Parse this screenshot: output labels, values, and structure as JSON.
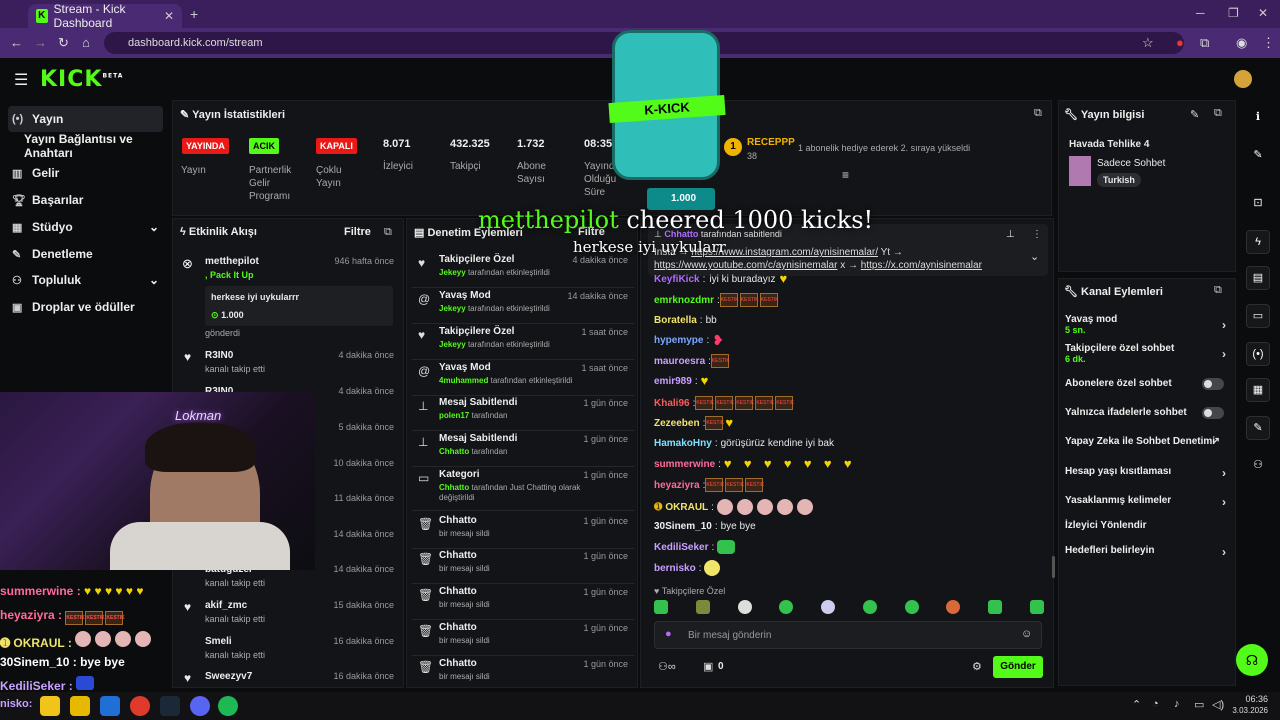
{
  "browser": {
    "tab_title": "Stream - Kick Dashboard",
    "url": "dashboard.kick.com/stream"
  },
  "logo": "KICK",
  "logo_tag": "BETA",
  "sidebar": {
    "items": [
      {
        "label": "Yayın",
        "icon": "broadcast-icon"
      },
      {
        "label": "Yayın Bağlantısı ve Anahtarı",
        "icon": ""
      },
      {
        "label": "Gelir",
        "icon": "chart-icon"
      },
      {
        "label": "Başarılar",
        "icon": "trophy-icon"
      },
      {
        "label": "Stüdyo",
        "icon": "studio-icon"
      },
      {
        "label": "Denetleme",
        "icon": "wrench-icon"
      },
      {
        "label": "Topluluk",
        "icon": "community-icon"
      },
      {
        "label": "Droplar ve ödüller",
        "icon": "gift-icon"
      }
    ]
  },
  "stats": {
    "title": "Yayın İstatistikleri",
    "status_badge": "YAYINDA",
    "status_label": "Yayın",
    "partner_badge": "ACIK",
    "partner_label": "Partnerlik Gelir Programı",
    "multi_badge": "KAPALI",
    "multi_label": "Çoklu Yayın",
    "viewers": "8.071",
    "viewers_label": "İzleyici",
    "followers": "432.325",
    "followers_label": "Takipçi",
    "subs": "1.732",
    "subs_label": "Abone Sayısı",
    "uptime": "08:35",
    "uptime_label": "Yayında Olduğu Süre"
  },
  "hype": {
    "rank": "1",
    "user": "RECEPPP",
    "count": "38",
    "message": "1 abonelik hediye ederek 2. sıraya yükseldi"
  },
  "cheer": {
    "amount": "1.000",
    "overlay_user": "metthepilot",
    "overlay_text": "cheered 1000 kicks!",
    "overlay_msg": "herkese iyi uykularr"
  },
  "activity": {
    "title": "Etkinlik Akışı",
    "filter": "Filtre",
    "items": [
      {
        "name": "metthepilot",
        "time": "946 hafta önce",
        "sub": "Pack It Up",
        "msg": "herkese iyi uykularrr",
        "amount": "1.000",
        "extra": "gönderdi"
      },
      {
        "name": "R3IN0",
        "time": "4 dakika önce",
        "sub": "kanalı takip etti"
      },
      {
        "name": "R3IN0",
        "time": "4 dakika önce",
        "sub": ""
      },
      {
        "name": "",
        "time": "5 dakika önce",
        "sub": ""
      },
      {
        "name": "",
        "time": "10 dakika önce",
        "sub": ""
      },
      {
        "name": "",
        "time": "11 dakika önce",
        "sub": ""
      },
      {
        "name": "",
        "time": "14 dakika önce",
        "sub": ""
      },
      {
        "name": "batuguzel",
        "time": "14 dakika önce",
        "sub": "kanalı takip etti"
      },
      {
        "name": "akif_zmc",
        "time": "15 dakika önce",
        "sub": "kanalı takip etti"
      },
      {
        "name": "Smeli",
        "time": "16 dakika önce",
        "sub": "kanalı takip etti"
      },
      {
        "name": "Sweezyv7",
        "time": "16 dakika önce",
        "sub": ""
      }
    ]
  },
  "moderation": {
    "title": "Denetim Eylemleri",
    "filter": "Filtre",
    "items": [
      {
        "name": "Takipçilere Özel",
        "user": "Jekeyy",
        "action": "tarafından etkinleştirildi",
        "time": "4 dakika önce",
        "icon": "heart-icon"
      },
      {
        "name": "Yavaş Mod",
        "user": "Jekeyy",
        "action": "tarafından etkinleştirildi",
        "time": "14 dakika önce",
        "icon": "snail-icon"
      },
      {
        "name": "Takipçilere Özel",
        "user": "Jekeyy",
        "action": "tarafından etkinleştirildi",
        "time": "1 saat önce",
        "icon": "heart-icon"
      },
      {
        "name": "Yavaş Mod",
        "user": "4muhammed",
        "action": "tarafından etkinleştirildi",
        "time": "1 saat önce",
        "icon": "snail-icon"
      },
      {
        "name": "Mesaj Sabitlendi",
        "user": "polen17",
        "action": "tarafından",
        "time": "1 gün önce",
        "icon": "pin-icon"
      },
      {
        "name": "Mesaj Sabitlendi",
        "user": "Chhatto",
        "action": "tarafından",
        "time": "1 gün önce",
        "icon": "pin-icon"
      },
      {
        "name": "Kategori",
        "user": "Chhatto",
        "action": "tarafından Just Chatting olarak değiştirildi",
        "time": "1 gün önce",
        "icon": "category-icon"
      },
      {
        "name": "Chhatto",
        "user": "",
        "action": "bir mesajı sildi",
        "time": "1 gün önce",
        "icon": "trash-icon"
      },
      {
        "name": "Chhatto",
        "user": "",
        "action": "bir mesajı sildi",
        "time": "1 gün önce",
        "icon": "trash-icon"
      },
      {
        "name": "Chhatto",
        "user": "",
        "action": "bir mesajı sildi",
        "time": "1 gün önce",
        "icon": "trash-icon"
      },
      {
        "name": "Chhatto",
        "user": "",
        "action": "bir mesajı sildi",
        "time": "1 gün önce",
        "icon": "trash-icon"
      },
      {
        "name": "Chhatto",
        "user": "",
        "action": "bir mesajı sildi",
        "time": "1 gün önce",
        "icon": "trash-icon"
      }
    ]
  },
  "pinned": {
    "by": "Chhatto",
    "by_text": "tarafından sabitlendi",
    "label": "Insta",
    "link1": "https://www.instagram.com/aynisinemalar/",
    "link2": "https://www.youtube.com/c/aynisinemalar",
    "link3": "https://x.com/aynisinemalar",
    "sep1": "Yt →",
    "sep2": "x →"
  },
  "chat": {
    "lines": [
      {
        "user": "KeyfiKick",
        "color": "#b46bff",
        "text": "iyi ki buradayız"
      },
      {
        "user": "emrknozdmr",
        "color": "#53fc18",
        "text": ""
      },
      {
        "user": "Boratella",
        "color": "#f0e46b",
        "text": "bb"
      },
      {
        "user": "hypemype",
        "color": "#7aa7ff",
        "text": ""
      },
      {
        "user": "mauroesra",
        "color": "#c8a0ff",
        "text": ""
      },
      {
        "user": "emir989",
        "color": "#c8a0ff",
        "text": ""
      },
      {
        "user": "Khali96",
        "color": "#ff5a5a",
        "text": ""
      },
      {
        "user": "Zezeeben",
        "color": "#f0e46b",
        "text": ""
      },
      {
        "user": "HamakoHny",
        "color": "#7de0ff",
        "text": "görüşürüz kendine iyi bak"
      },
      {
        "user": "summerwine",
        "color": "#ff6b9a",
        "text": ""
      },
      {
        "user": "heyaziyra",
        "color": "#ff6b9a",
        "text": ""
      },
      {
        "user": "OKRAUL",
        "color": "#f0e46b",
        "text": ""
      },
      {
        "user": "30Sinem_10",
        "color": "#eeeeee",
        "text": "bye bye"
      },
      {
        "user": "KediliSeker",
        "color": "#c8a0ff",
        "text": ""
      },
      {
        "user": "bernisko",
        "color": "#c8a0ff",
        "text": ""
      }
    ],
    "followers_only": "Takipçilere Özel",
    "placeholder": "Bir mesaj gönderin",
    "kicks": "0",
    "send": "Gönder"
  },
  "stream_info": {
    "title": "Yayın bilgisi",
    "stream_title": "Havada Tehlike 4",
    "category": "Sadece Sohbet",
    "language": "Turkish"
  },
  "channel_actions": {
    "title": "Kanal Eylemleri",
    "items": [
      {
        "label": "Yavaş mod",
        "sub": "5 sn.",
        "control": "chevron"
      },
      {
        "label": "Takipçilere özel sohbet",
        "sub": "6 dk.",
        "control": "chevron"
      },
      {
        "label": "Abonelere özel sohbet",
        "sub": "",
        "control": "toggle"
      },
      {
        "label": "Yalnızca ifadelerle sohbet",
        "sub": "",
        "control": "toggle"
      },
      {
        "label": "Yapay Zeka ile Sohbet Denetimi",
        "sub": "",
        "control": "external"
      },
      {
        "label": "Hesap yaşı kısıtlaması",
        "sub": "",
        "control": "chevron"
      },
      {
        "label": "Yasaklanmış kelimeler",
        "sub": "",
        "control": "chevron"
      },
      {
        "label": "İzleyici Yönlendir",
        "sub": "",
        "control": "none"
      },
      {
        "label": "Hedefleri belirleyin",
        "sub": "",
        "control": "chevron"
      }
    ]
  },
  "overlay": {
    "lines": [
      {
        "user": "summerwine",
        "color": "#ff6b9a"
      },
      {
        "user": "heyaziyra",
        "color": "#ff6b9a"
      },
      {
        "user": "OKRAUL",
        "color": "#f0e46b"
      },
      {
        "user": "30Sinem_10",
        "color": "#ffffff",
        "text": "bye bye"
      },
      {
        "user": "KediliSeker",
        "color": "#c8a0ff"
      },
      {
        "user": "nisko",
        "color": "#c8a0ff"
      }
    ]
  },
  "taskbar": {
    "time": "06:36",
    "date": "3.03.2026"
  }
}
